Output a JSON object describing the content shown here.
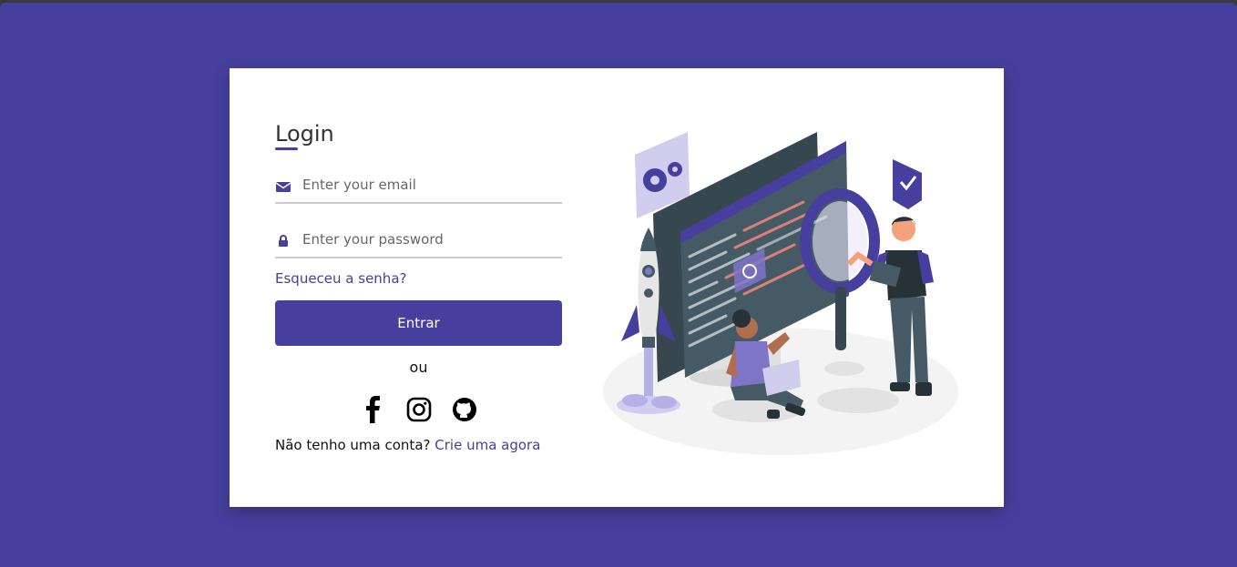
{
  "login": {
    "title": "Login",
    "email_placeholder": "Enter your email",
    "password_placeholder": "Enter your password",
    "forgot_link": "Esqueceu a senha?",
    "submit_label": "Entrar",
    "or_text": "ou",
    "social_icons": [
      "facebook-icon",
      "instagram-icon",
      "github-icon"
    ],
    "signup_prompt": "Não tenho uma conta?",
    "signup_link": "Crie uma agora"
  },
  "colors": {
    "background": "#473f9d",
    "accent": "#473f9d",
    "card": "#ffffff"
  }
}
